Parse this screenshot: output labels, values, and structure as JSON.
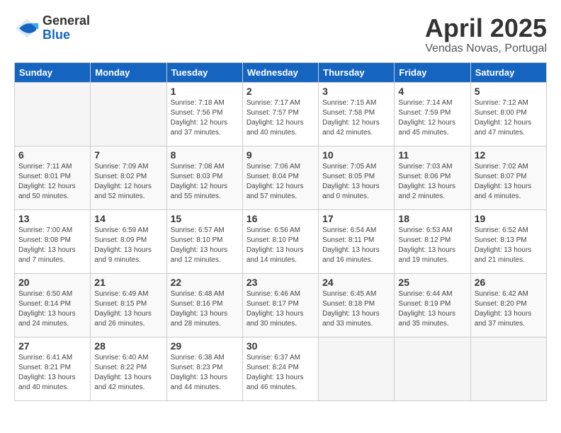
{
  "header": {
    "logo_general": "General",
    "logo_blue": "Blue",
    "month_title": "April 2025",
    "location": "Vendas Novas, Portugal"
  },
  "weekdays": [
    "Sunday",
    "Monday",
    "Tuesday",
    "Wednesday",
    "Thursday",
    "Friday",
    "Saturday"
  ],
  "weeks": [
    [
      {
        "day": "",
        "info": ""
      },
      {
        "day": "",
        "info": ""
      },
      {
        "day": "1",
        "info": "Sunrise: 7:18 AM\nSunset: 7:56 PM\nDaylight: 12 hours and 37 minutes."
      },
      {
        "day": "2",
        "info": "Sunrise: 7:17 AM\nSunset: 7:57 PM\nDaylight: 12 hours and 40 minutes."
      },
      {
        "day": "3",
        "info": "Sunrise: 7:15 AM\nSunset: 7:58 PM\nDaylight: 12 hours and 42 minutes."
      },
      {
        "day": "4",
        "info": "Sunrise: 7:14 AM\nSunset: 7:59 PM\nDaylight: 12 hours and 45 minutes."
      },
      {
        "day": "5",
        "info": "Sunrise: 7:12 AM\nSunset: 8:00 PM\nDaylight: 12 hours and 47 minutes."
      }
    ],
    [
      {
        "day": "6",
        "info": "Sunrise: 7:11 AM\nSunset: 8:01 PM\nDaylight: 12 hours and 50 minutes."
      },
      {
        "day": "7",
        "info": "Sunrise: 7:09 AM\nSunset: 8:02 PM\nDaylight: 12 hours and 52 minutes."
      },
      {
        "day": "8",
        "info": "Sunrise: 7:08 AM\nSunset: 8:03 PM\nDaylight: 12 hours and 55 minutes."
      },
      {
        "day": "9",
        "info": "Sunrise: 7:06 AM\nSunset: 8:04 PM\nDaylight: 12 hours and 57 minutes."
      },
      {
        "day": "10",
        "info": "Sunrise: 7:05 AM\nSunset: 8:05 PM\nDaylight: 13 hours and 0 minutes."
      },
      {
        "day": "11",
        "info": "Sunrise: 7:03 AM\nSunset: 8:06 PM\nDaylight: 13 hours and 2 minutes."
      },
      {
        "day": "12",
        "info": "Sunrise: 7:02 AM\nSunset: 8:07 PM\nDaylight: 13 hours and 4 minutes."
      }
    ],
    [
      {
        "day": "13",
        "info": "Sunrise: 7:00 AM\nSunset: 8:08 PM\nDaylight: 13 hours and 7 minutes."
      },
      {
        "day": "14",
        "info": "Sunrise: 6:59 AM\nSunset: 8:09 PM\nDaylight: 13 hours and 9 minutes."
      },
      {
        "day": "15",
        "info": "Sunrise: 6:57 AM\nSunset: 8:10 PM\nDaylight: 13 hours and 12 minutes."
      },
      {
        "day": "16",
        "info": "Sunrise: 6:56 AM\nSunset: 8:10 PM\nDaylight: 13 hours and 14 minutes."
      },
      {
        "day": "17",
        "info": "Sunrise: 6:54 AM\nSunset: 8:11 PM\nDaylight: 13 hours and 16 minutes."
      },
      {
        "day": "18",
        "info": "Sunrise: 6:53 AM\nSunset: 8:12 PM\nDaylight: 13 hours and 19 minutes."
      },
      {
        "day": "19",
        "info": "Sunrise: 6:52 AM\nSunset: 8:13 PM\nDaylight: 13 hours and 21 minutes."
      }
    ],
    [
      {
        "day": "20",
        "info": "Sunrise: 6:50 AM\nSunset: 8:14 PM\nDaylight: 13 hours and 24 minutes."
      },
      {
        "day": "21",
        "info": "Sunrise: 6:49 AM\nSunset: 8:15 PM\nDaylight: 13 hours and 26 minutes."
      },
      {
        "day": "22",
        "info": "Sunrise: 6:48 AM\nSunset: 8:16 PM\nDaylight: 13 hours and 28 minutes."
      },
      {
        "day": "23",
        "info": "Sunrise: 6:46 AM\nSunset: 8:17 PM\nDaylight: 13 hours and 30 minutes."
      },
      {
        "day": "24",
        "info": "Sunrise: 6:45 AM\nSunset: 8:18 PM\nDaylight: 13 hours and 33 minutes."
      },
      {
        "day": "25",
        "info": "Sunrise: 6:44 AM\nSunset: 8:19 PM\nDaylight: 13 hours and 35 minutes."
      },
      {
        "day": "26",
        "info": "Sunrise: 6:42 AM\nSunset: 8:20 PM\nDaylight: 13 hours and 37 minutes."
      }
    ],
    [
      {
        "day": "27",
        "info": "Sunrise: 6:41 AM\nSunset: 8:21 PM\nDaylight: 13 hours and 40 minutes."
      },
      {
        "day": "28",
        "info": "Sunrise: 6:40 AM\nSunset: 8:22 PM\nDaylight: 13 hours and 42 minutes."
      },
      {
        "day": "29",
        "info": "Sunrise: 6:38 AM\nSunset: 8:23 PM\nDaylight: 13 hours and 44 minutes."
      },
      {
        "day": "30",
        "info": "Sunrise: 6:37 AM\nSunset: 8:24 PM\nDaylight: 13 hours and 46 minutes."
      },
      {
        "day": "",
        "info": ""
      },
      {
        "day": "",
        "info": ""
      },
      {
        "day": "",
        "info": ""
      }
    ]
  ]
}
